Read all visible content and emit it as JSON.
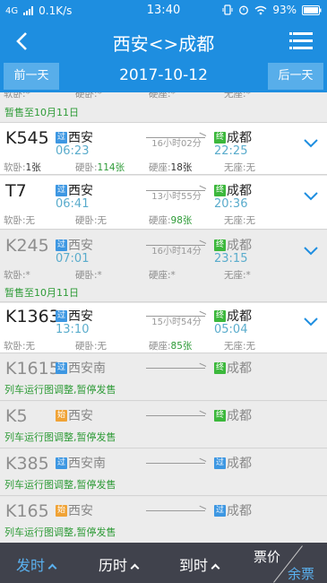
{
  "status_bar": {
    "network_type": "4G",
    "speed": "0.1K/s",
    "time": "13:40",
    "battery": "93%"
  },
  "nav": {
    "title": "西安<>成都"
  },
  "date_bar": {
    "prev_label": "前一天",
    "date": "2017-10-12",
    "next_label": "后一天"
  },
  "colors": {
    "primary": "#1e8ee0",
    "pass_badge": "#3d97e2",
    "terminal_badge": "#3cb83c",
    "origin_badge": "#f0a336",
    "green_text": "#2e9b37",
    "bottom_bar": "#40424c"
  },
  "trains": [
    {
      "code": "",
      "active": false,
      "seats": [
        {
          "label": "软卧:",
          "value": "*"
        },
        {
          "label": "硬卧:",
          "value": "*"
        },
        {
          "label": "硬座:",
          "value": "*"
        },
        {
          "label": "无座:",
          "value": "*"
        }
      ],
      "notice": "暂售至10月11日"
    },
    {
      "code": "K545",
      "active": true,
      "from_badge": "过",
      "from": "西安",
      "depart": "06:23",
      "duration": "16小时02分",
      "to_badge": "终",
      "to": "成都",
      "arrive": "22:25",
      "seats": [
        {
          "label": "软卧:",
          "value": "1张"
        },
        {
          "label": "硬卧:",
          "value": "114张"
        },
        {
          "label": "硬座:",
          "value": "18张"
        },
        {
          "label": "无座:",
          "value": "无"
        }
      ]
    },
    {
      "code": "T7",
      "active": true,
      "from_badge": "过",
      "from": "西安",
      "depart": "06:41",
      "duration": "13小时55分",
      "to_badge": "终",
      "to": "成都",
      "arrive": "20:36",
      "seats": [
        {
          "label": "软卧:",
          "value": "无"
        },
        {
          "label": "硬卧:",
          "value": "无"
        },
        {
          "label": "硬座:",
          "value": "98张"
        },
        {
          "label": "无座:",
          "value": "无"
        }
      ]
    },
    {
      "code": "K245",
      "active": false,
      "from_badge": "过",
      "from": "西安",
      "depart": "07:01",
      "duration": "16小时14分",
      "to_badge": "终",
      "to": "成都",
      "arrive": "23:15",
      "seats": [
        {
          "label": "软卧:",
          "value": "*"
        },
        {
          "label": "硬卧:",
          "value": "*"
        },
        {
          "label": "硬座:",
          "value": "*"
        },
        {
          "label": "无座:",
          "value": "*"
        }
      ],
      "notice": "暂售至10月11日"
    },
    {
      "code": "K1363",
      "active": true,
      "from_badge": "过",
      "from": "西安",
      "depart": "13:10",
      "duration": "15小时54分",
      "to_badge": "终",
      "to": "成都",
      "arrive": "05:04",
      "seats": [
        {
          "label": "软卧:",
          "value": "无"
        },
        {
          "label": "硬卧:",
          "value": "无"
        },
        {
          "label": "硬座:",
          "value": "85张"
        },
        {
          "label": "无座:",
          "value": "无"
        }
      ]
    },
    {
      "code": "K1615",
      "active": false,
      "from_badge": "过",
      "from": "西安南",
      "to_badge": "终",
      "to": "成都",
      "notice": "列车运行图调整,暂停发售"
    },
    {
      "code": "K5",
      "active": false,
      "from_badge": "始",
      "from": "西安",
      "to_badge": "终",
      "to": "成都",
      "notice": "列车运行图调整,暂停发售"
    },
    {
      "code": "K385",
      "active": false,
      "from_badge": "过",
      "from": "西安南",
      "to_badge": "过",
      "to": "成都",
      "notice": "列车运行图调整,暂停发售"
    },
    {
      "code": "K165",
      "active": false,
      "from_badge": "始",
      "from": "西安",
      "to_badge": "过",
      "to": "成都",
      "notice": "列车运行图调整,暂停发售"
    }
  ],
  "bottom_bar": {
    "depart_sort": "发时",
    "duration_sort": "历时",
    "arrive_sort": "到时",
    "price_label": "票价",
    "remaining_label": "余票"
  }
}
